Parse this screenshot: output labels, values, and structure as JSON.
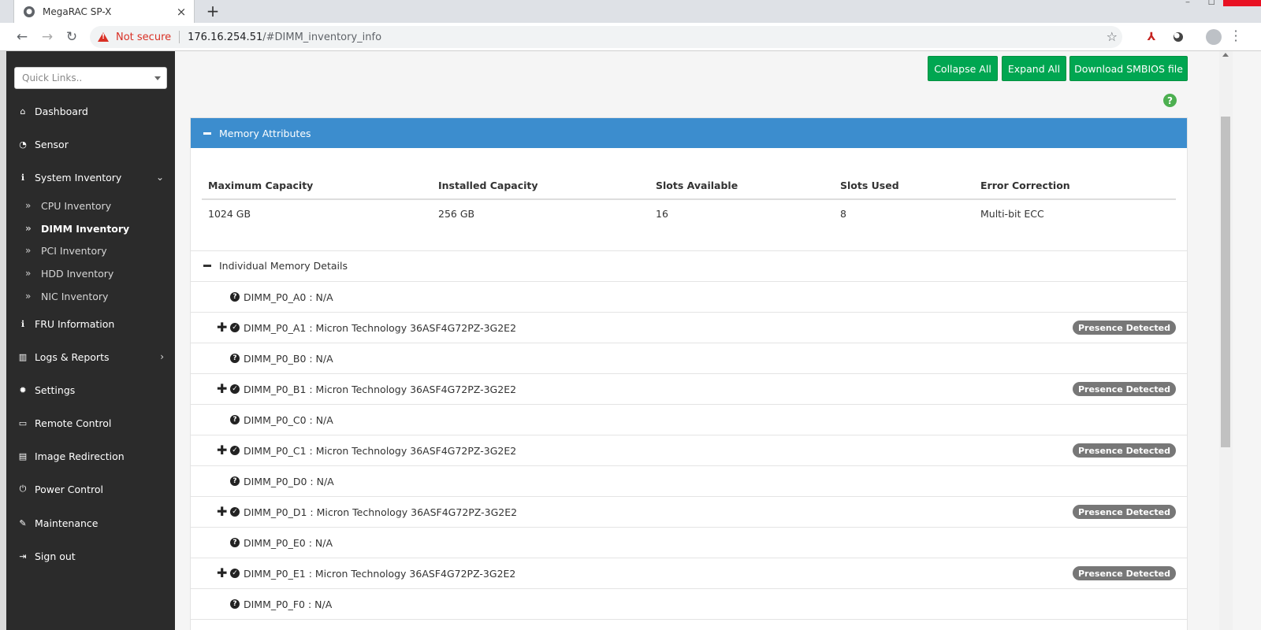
{
  "browser": {
    "tab_title": "MegaRAC SP-X",
    "tab_close": "×",
    "new_tab": "+",
    "not_secure": "Not secure",
    "url_host": "176.16.254.51",
    "url_path": "/#DIMM_inventory_info"
  },
  "sidebar": {
    "quicklinks_placeholder": "Quick Links..",
    "items": [
      {
        "label": "Dashboard",
        "icon": "home-icon"
      },
      {
        "label": "Sensor",
        "icon": "gauge-icon"
      },
      {
        "label": "System Inventory",
        "icon": "info-icon"
      },
      {
        "label": "FRU Information",
        "icon": "info-icon"
      },
      {
        "label": "Logs & Reports",
        "icon": "bar-chart-icon"
      },
      {
        "label": "Settings",
        "icon": "gear-icon"
      },
      {
        "label": "Remote Control",
        "icon": "monitor-icon"
      },
      {
        "label": "Image Redirection",
        "icon": "drive-icon"
      },
      {
        "label": "Power Control",
        "icon": "power-icon"
      },
      {
        "label": "Maintenance",
        "icon": "wrench-icon"
      },
      {
        "label": "Sign out",
        "icon": "sign-out-icon"
      }
    ],
    "sub_items": [
      {
        "label": "CPU Inventory"
      },
      {
        "label": "DIMM Inventory"
      },
      {
        "label": "PCI Inventory"
      },
      {
        "label": "HDD Inventory"
      },
      {
        "label": "NIC Inventory"
      }
    ]
  },
  "actions": {
    "collapse_all": "Collapse All",
    "expand_all": "Expand All",
    "download_smbios": "Download SMBIOS file"
  },
  "panel": {
    "title": "Memory Attributes",
    "headers": [
      "Maximum Capacity",
      "Installed Capacity",
      "Slots Available",
      "Slots Used",
      "Error Correction"
    ],
    "values": [
      "1024 GB",
      "256 GB",
      "16",
      "8",
      "Multi-bit ECC"
    ],
    "details_title": "Individual Memory Details"
  },
  "dimms": [
    {
      "text": "DIMM_P0_A0 : N/A",
      "present": false
    },
    {
      "text": "DIMM_P0_A1 : Micron Technology 36ASF4G72PZ-3G2E2",
      "present": true,
      "badge": "Presence Detected"
    },
    {
      "text": "DIMM_P0_B0 : N/A",
      "present": false
    },
    {
      "text": "DIMM_P0_B1 : Micron Technology 36ASF4G72PZ-3G2E2",
      "present": true,
      "badge": "Presence Detected"
    },
    {
      "text": "DIMM_P0_C0 : N/A",
      "present": false
    },
    {
      "text": "DIMM_P0_C1 : Micron Technology 36ASF4G72PZ-3G2E2",
      "present": true,
      "badge": "Presence Detected"
    },
    {
      "text": "DIMM_P0_D0 : N/A",
      "present": false
    },
    {
      "text": "DIMM_P0_D1 : Micron Technology 36ASF4G72PZ-3G2E2",
      "present": true,
      "badge": "Presence Detected"
    },
    {
      "text": "DIMM_P0_E0 : N/A",
      "present": false
    },
    {
      "text": "DIMM_P0_E1 : Micron Technology 36ASF4G72PZ-3G2E2",
      "present": true,
      "badge": "Presence Detected"
    },
    {
      "text": "DIMM_P0_F0 : N/A",
      "present": false
    }
  ]
}
